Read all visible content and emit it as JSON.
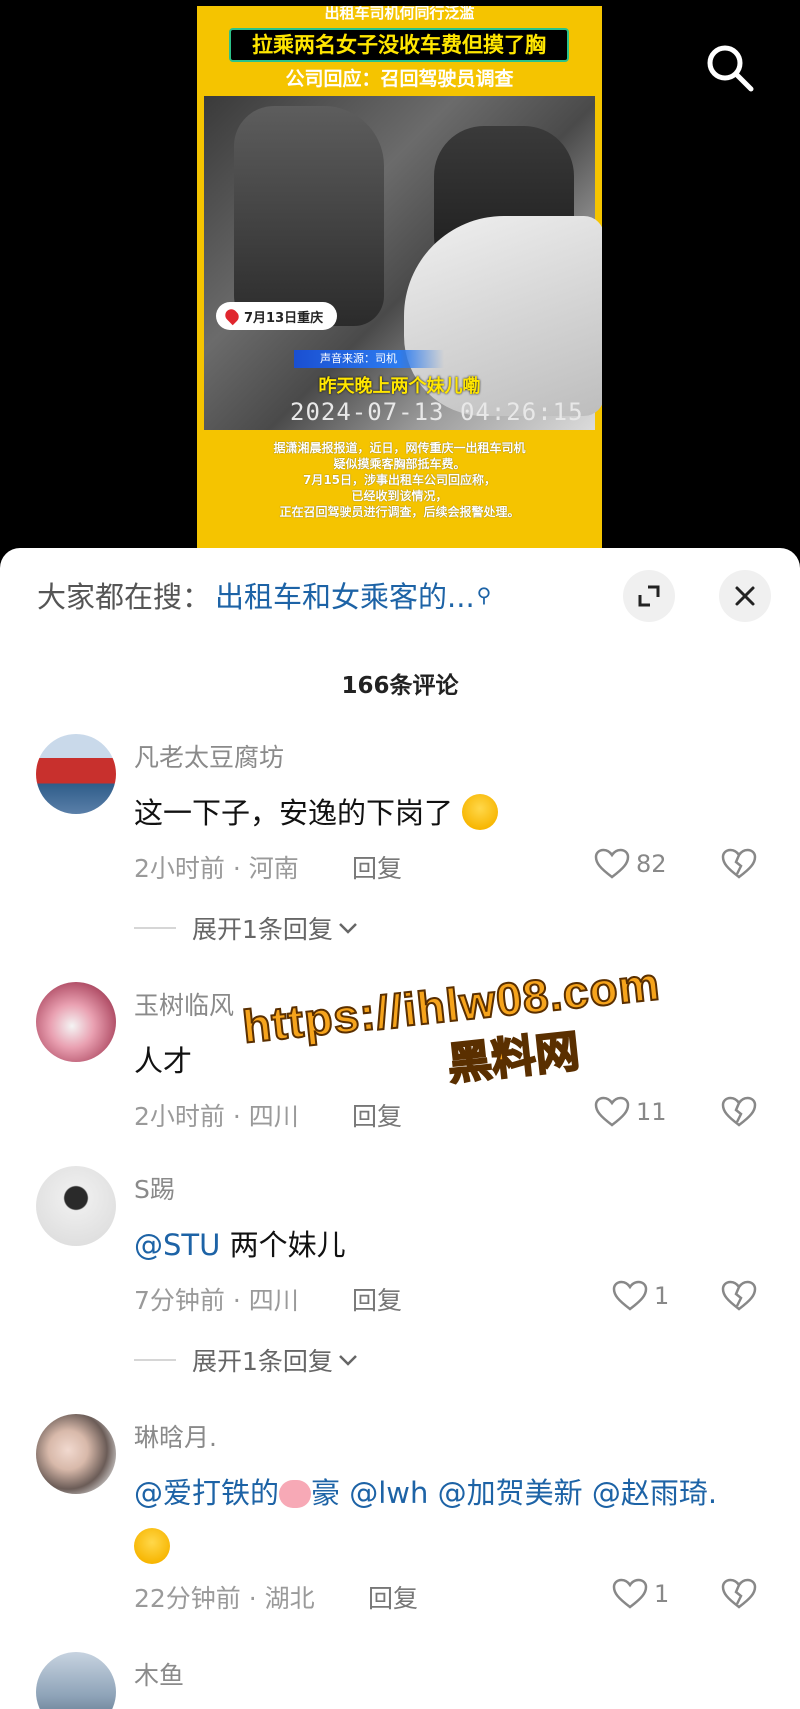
{
  "video": {
    "top_line": "出租车司机何同行泛滥",
    "title": "拉乘两名女子没收车费但摸了胸",
    "subtitle": "公司回应：召回驾驶员调查",
    "location_badge": "7月13日重庆",
    "source_label": "声音来源：司机",
    "caption": "昨天晚上两个妹儿嘞",
    "timestamp": "2024-07-13  04:26:15",
    "news_lines": [
      "据潇湘晨报报道，近日，网传重庆一出租车司机",
      "疑似摸乘客胸部抵车费。",
      "7月15日，涉事出租车公司回应称，",
      "已经收到该情况，",
      "正在召回驾驶员进行调查，后续会报警处理。"
    ]
  },
  "sheet": {
    "search_prefix": "大家都在搜：",
    "search_query": "出租车和女乘客的...",
    "comments_count": "166条评论"
  },
  "comments": [
    {
      "user": "凡老太豆腐坊",
      "text": "这一下子，安逸的下岗了",
      "time_location": "2小时前 · 河南",
      "reply": "回复",
      "likes": "82",
      "expand": "展开1条回复"
    },
    {
      "user": "玉树临风",
      "text": "人才",
      "time_location": "2小时前 · 四川",
      "reply": "回复",
      "likes": "11"
    },
    {
      "user": "S踢",
      "mention": "@STU",
      "text": " 两个妹儿",
      "time_location": "7分钟前 · 四川",
      "reply": "回复",
      "likes": "1",
      "expand": "展开1条回复"
    },
    {
      "user": "琳晗月.",
      "mention1": "@爱打铁的",
      "mention1b": "豪",
      "mention2": "@lwh",
      "mention3": "@加贺美新",
      "mention4": "@赵雨琦.",
      "time_location": "22分钟前 · 湖北",
      "reply": "回复",
      "likes": "1"
    },
    {
      "user": "木鱼"
    }
  ],
  "watermark": {
    "url": "https://ihlw08.com",
    "name": "黑料网"
  },
  "icons": {
    "search": "search-icon",
    "expand": "expand-icon",
    "close": "close-icon",
    "like": "heart-icon",
    "dislike": "broken-heart-icon",
    "expand_replies": "chevron-down-icon"
  },
  "colors": {
    "accent_link": "#1d63a6",
    "video_bg": "#f5c400",
    "watermark": "#f6a41c"
  }
}
